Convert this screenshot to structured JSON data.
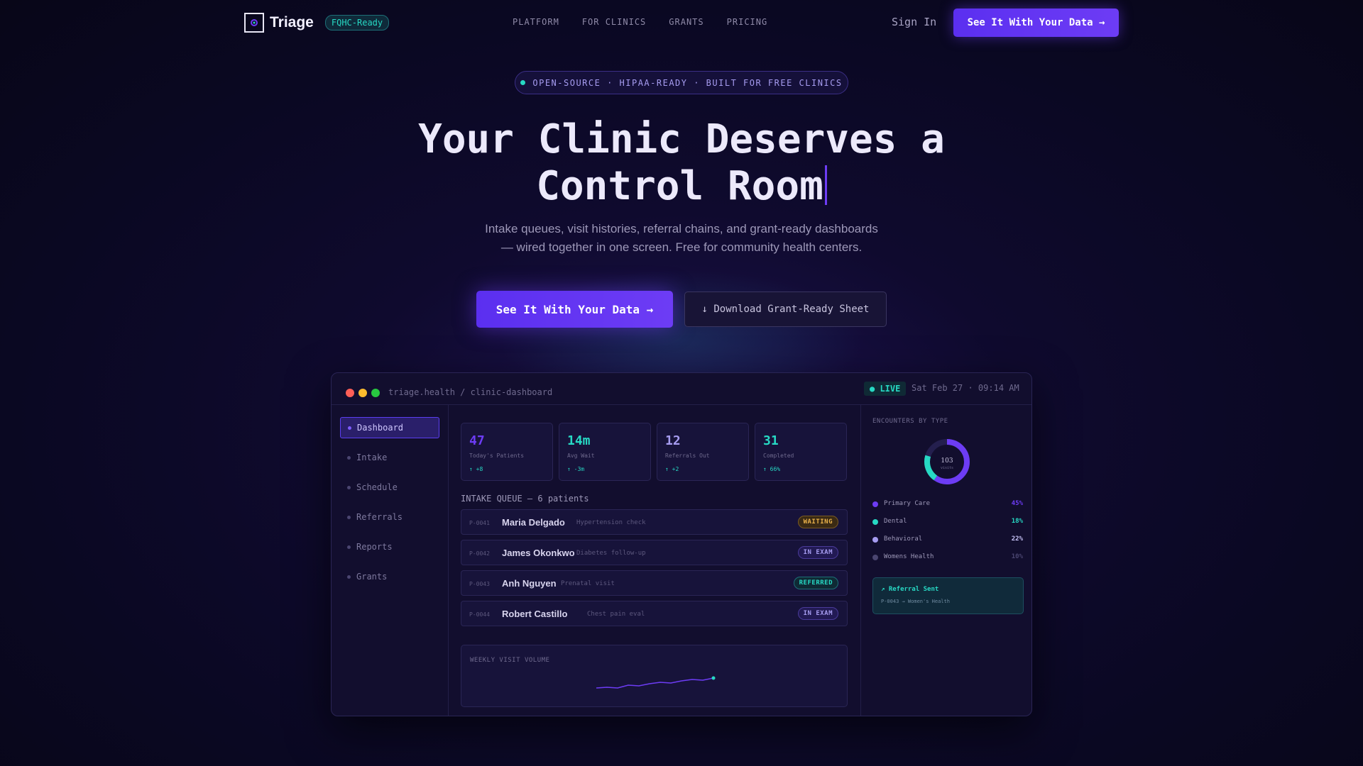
{
  "nav": {
    "brand": "Triage",
    "badge": "FQHC-Ready",
    "links": [
      "PLATFORM",
      "FOR CLINICS",
      "GRANTS",
      "PRICING"
    ],
    "sign_in": "Sign In",
    "cta": "See It With Your Data →"
  },
  "hero": {
    "pill": "OPEN-SOURCE · HIPAA-READY · BUILT FOR FREE CLINICS",
    "title_line1": "Your Clinic Deserves a",
    "title_line2": "Control Room",
    "subtitle_line1": "Intake queues, visit histories, referral chains, and grant-ready dashboards",
    "subtitle_line2": "— wired together in one screen. Free for community health centers.",
    "cta_primary": "See It With Your Data →",
    "cta_secondary": "↓ Download Grant-Ready Sheet"
  },
  "dashboard": {
    "url": "triage.health / clinic-dashboard",
    "live": "● LIVE",
    "date": "Sat Feb 27 · 09:14 AM",
    "sidebar": [
      "Dashboard",
      "Intake",
      "Schedule",
      "Referrals",
      "Reports",
      "Grants"
    ],
    "stats": [
      {
        "value": "47",
        "label": "Today's Patients",
        "delta": "↑ +8",
        "color": "#6d3cf5"
      },
      {
        "value": "14m",
        "label": "Avg Wait",
        "delta": "↑ -3m",
        "color": "#27d9c4"
      },
      {
        "value": "12",
        "label": "Referrals Out",
        "delta": "↑ +2",
        "color": "#a69cf0"
      },
      {
        "value": "31",
        "label": "Completed",
        "delta": "↑ 66%",
        "color": "#27d9c4"
      }
    ],
    "queue_title": "INTAKE QUEUE — 6 patients",
    "queue": [
      {
        "id": "P-0041",
        "name": "Maria Delgado",
        "reason": "Hypertension check",
        "status": "WAITING"
      },
      {
        "id": "P-0042",
        "name": "James Okonkwo",
        "reason": "Diabetes follow-up",
        "status": "IN EXAM"
      },
      {
        "id": "P-0043",
        "name": "Anh Nguyen",
        "reason": "Prenatal visit",
        "status": "REFERRED"
      },
      {
        "id": "P-0044",
        "name": "Robert Castillo",
        "reason": "Chest pain eval",
        "status": "IN EXAM"
      }
    ],
    "weekly_title": "WEEKLY VISIT VOLUME",
    "encounters_title": "ENCOUNTERS BY TYPE",
    "donut_center": "103",
    "donut_sub": "visits",
    "encounters": [
      {
        "label": "Primary Care",
        "pct": "45%",
        "color": "#6d3cf5"
      },
      {
        "label": "Dental",
        "pct": "18%",
        "color": "#27d9c4"
      },
      {
        "label": "Behavioral",
        "pct": "22%",
        "color": "#a69cf0"
      },
      {
        "label": "Womens Health",
        "pct": "10%",
        "color": "#4a4570"
      }
    ],
    "referral_title": "↗ Referral Sent",
    "referral_sub": "P-0043 → Women's Health"
  }
}
